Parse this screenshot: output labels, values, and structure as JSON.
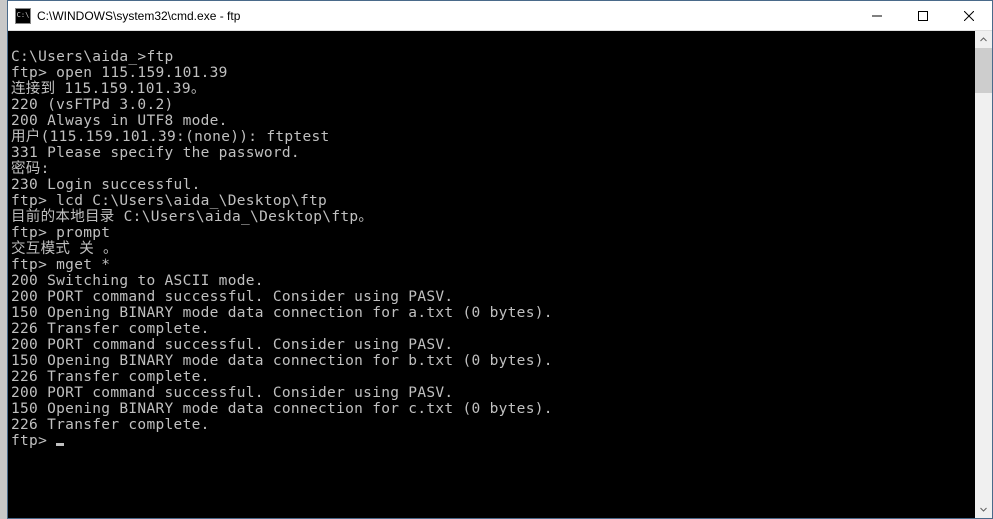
{
  "window": {
    "title": "C:\\WINDOWS\\system32\\cmd.exe - ftp",
    "icon_label": "C:\\"
  },
  "terminal": {
    "lines": [
      "",
      "C:\\Users\\aida_>ftp",
      "ftp> open 115.159.101.39",
      "连接到 115.159.101.39。",
      "220 (vsFTPd 3.0.2)",
      "200 Always in UTF8 mode.",
      "用户(115.159.101.39:(none)): ftptest",
      "331 Please specify the password.",
      "密码:",
      "230 Login successful.",
      "ftp> lcd C:\\Users\\aida_\\Desktop\\ftp",
      "目前的本地目录 C:\\Users\\aida_\\Desktop\\ftp。",
      "ftp> prompt",
      "交互模式 关 。",
      "ftp> mget *",
      "200 Switching to ASCII mode.",
      "200 PORT command successful. Consider using PASV.",
      "150 Opening BINARY mode data connection for a.txt (0 bytes).",
      "226 Transfer complete.",
      "200 PORT command successful. Consider using PASV.",
      "150 Opening BINARY mode data connection for b.txt (0 bytes).",
      "226 Transfer complete.",
      "200 PORT command successful. Consider using PASV.",
      "150 Opening BINARY mode data connection for c.txt (0 bytes).",
      "226 Transfer complete."
    ],
    "prompt": "ftp> "
  }
}
